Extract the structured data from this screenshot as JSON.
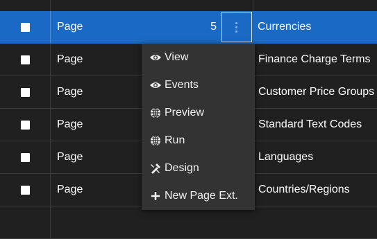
{
  "rows": [
    {
      "type": "Page",
      "id": "5",
      "name": "Currencies"
    },
    {
      "type": "Page",
      "id": "",
      "name": "Finance Charge Terms"
    },
    {
      "type": "Page",
      "id": "",
      "name": "Customer Price Groups"
    },
    {
      "type": "Page",
      "id": "",
      "name": "Standard Text Codes"
    },
    {
      "type": "Page",
      "id": "",
      "name": "Languages"
    },
    {
      "type": "Page",
      "id": "",
      "name": "Countries/Regions"
    }
  ],
  "context_menu": {
    "items": [
      {
        "label": "View",
        "icon": "eye-icon"
      },
      {
        "label": "Events",
        "icon": "eye-icon"
      },
      {
        "label": "Preview",
        "icon": "globe-icon"
      },
      {
        "label": "Run",
        "icon": "globe-icon"
      },
      {
        "label": "Design",
        "icon": "tools-icon"
      },
      {
        "label": "New Page Ext.",
        "icon": "plus-icon"
      }
    ]
  },
  "colors": {
    "selected_row": "#1a69c4",
    "background": "#202020",
    "menu_background": "#333333"
  }
}
